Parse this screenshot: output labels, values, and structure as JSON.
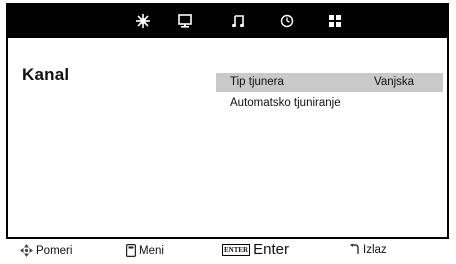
{
  "top_icons": [
    {
      "name": "picture-icon"
    },
    {
      "name": "sound-icon"
    },
    {
      "name": "music-icon"
    },
    {
      "name": "time-icon"
    },
    {
      "name": "setup-icon"
    }
  ],
  "menu": {
    "title": "Kanal",
    "items": [
      {
        "label": "Tip tjunera",
        "value": "Vanjska",
        "selected": true
      },
      {
        "label": "Automatsko tjuniranje",
        "value": "",
        "selected": false
      }
    ]
  },
  "footer": {
    "move_label": "Pomeri",
    "menu_label": "Meni",
    "enter_key": "ENTER",
    "enter_label": "Enter",
    "exit_label": "Izlaz"
  }
}
